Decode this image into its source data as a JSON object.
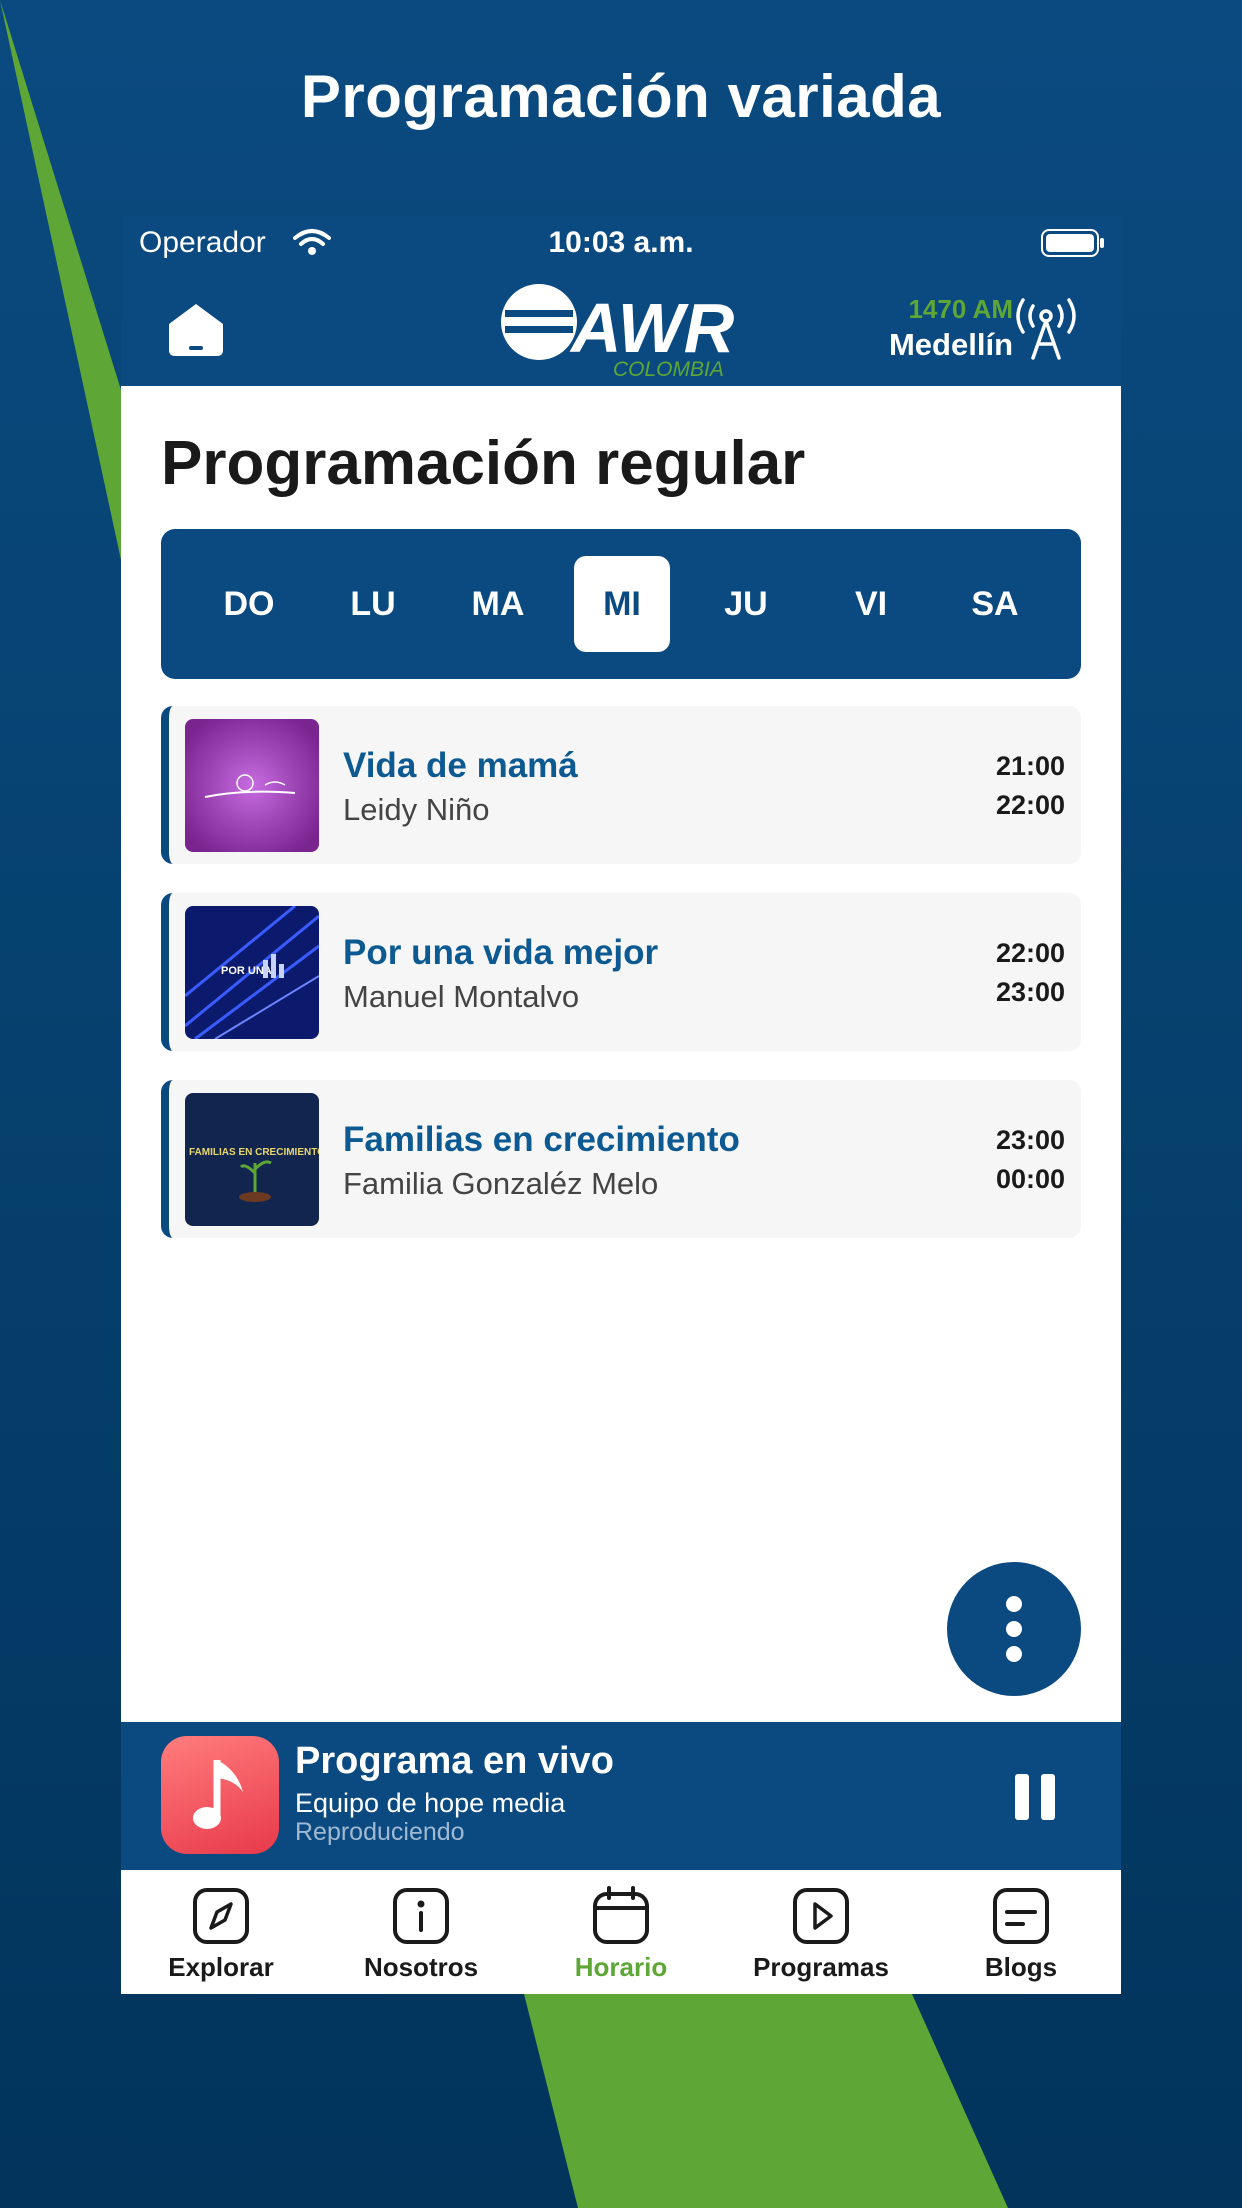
{
  "promo": {
    "title": "Programación variada"
  },
  "status_bar": {
    "operator": "Operador",
    "time": "10:03 a.m."
  },
  "header": {
    "logo_text": "AWR",
    "logo_sub": "COLOMBIA",
    "frequency": "1470 AM",
    "city": "Medellín",
    "icons": [
      "home-icon",
      "antenna-icon"
    ]
  },
  "schedule": {
    "title": "Programación regular",
    "days": [
      {
        "label": "DO",
        "selected": false
      },
      {
        "label": "LU",
        "selected": false
      },
      {
        "label": "MA",
        "selected": false
      },
      {
        "label": "MI",
        "selected": true
      },
      {
        "label": "JU",
        "selected": false
      },
      {
        "label": "VI",
        "selected": false
      },
      {
        "label": "SA",
        "selected": false
      }
    ],
    "programs": [
      {
        "title": "Vida de mamá",
        "host": "Leidy Niño",
        "start": "21:00",
        "end": "22:00"
      },
      {
        "title": "Por una vida mejor",
        "host": "Manuel Montalvo",
        "start": "22:00",
        "end": "23:00",
        "thumb_text": "POR UNA"
      },
      {
        "title": "Familias en crecimiento",
        "host": "Familia Gonzaléz Melo",
        "start": "23:00",
        "end": "00:00",
        "thumb_text": "FAMILIAS EN CRECIMIENTO"
      }
    ]
  },
  "player": {
    "title": "Programa en vivo",
    "subtitle": "Equipo de hope media",
    "status": "Reproduciendo",
    "state": "playing"
  },
  "tabs": [
    {
      "label": "Explorar",
      "icon": "compass-icon",
      "active": false
    },
    {
      "label": "Nosotros",
      "icon": "info-icon",
      "active": false
    },
    {
      "label": "Horario",
      "icon": "calendar-icon",
      "active": true
    },
    {
      "label": "Programas",
      "icon": "play-icon",
      "active": false
    },
    {
      "label": "Blogs",
      "icon": "blog-icon",
      "active": false
    }
  ],
  "colors": {
    "primary": "#0b4a80",
    "accent_green": "#5ea635",
    "title_blue": "#0d5a92"
  }
}
